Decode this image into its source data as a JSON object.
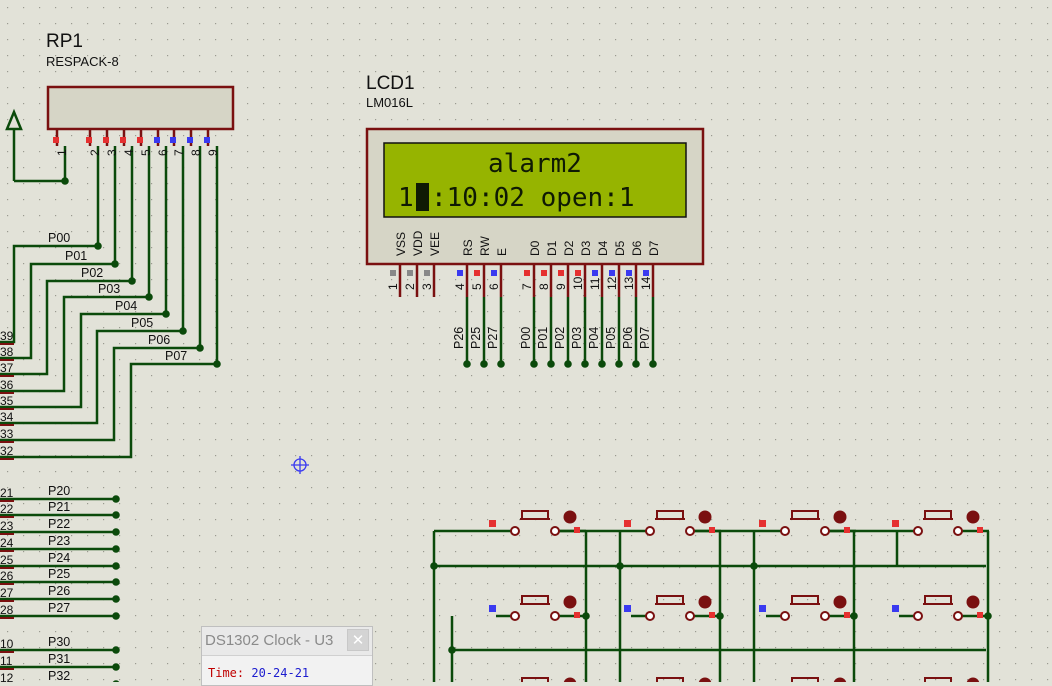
{
  "rp1": {
    "ref": "RP1",
    "value": "RESPACK-8",
    "pins": [
      "1",
      "2",
      "3",
      "4",
      "5",
      "6",
      "7",
      "8",
      "9"
    ]
  },
  "lcd": {
    "ref": "LCD1",
    "value": "LM016L",
    "line1": "alarm2",
    "line2_a": "1",
    "line2_b": ":10:02 open:1",
    "pin_names": [
      "VSS",
      "VDD",
      "VEE",
      "RS",
      "RW",
      "E",
      "D0",
      "D1",
      "D2",
      "D3",
      "D4",
      "D5",
      "D6",
      "D7"
    ],
    "pin_numbers": [
      "1",
      "2",
      "3",
      "4",
      "5",
      "6",
      "7",
      "8",
      "9",
      "10",
      "11",
      "12",
      "13",
      "14"
    ],
    "net_labels": [
      "P26",
      "P25",
      "P27",
      "P00",
      "P01",
      "P02",
      "P03",
      "P04",
      "P05",
      "P06",
      "P07"
    ]
  },
  "p0_labels": [
    "P00",
    "P01",
    "P02",
    "P03",
    "P04",
    "P05",
    "P06",
    "P07"
  ],
  "p0_pins": [
    "39",
    "38",
    "37",
    "36",
    "35",
    "34",
    "33",
    "32"
  ],
  "p2_labels": [
    "P20",
    "P21",
    "P22",
    "P23",
    "P24",
    "P25",
    "P26",
    "P27"
  ],
  "p2_pins": [
    "21",
    "22",
    "23",
    "24",
    "25",
    "26",
    "27",
    "28"
  ],
  "p3_labels": [
    "P30",
    "P31",
    "P32"
  ],
  "p3_pins": [
    "10",
    "11",
    "12"
  ],
  "popup": {
    "title": "DS1302 Clock - U3",
    "close": "✕",
    "time_label": "Time:",
    "time_value": "20-24-21"
  },
  "colors": {
    "wire": "#0b4a0b",
    "component": "#7a1010",
    "lcd_screen": "#96b400",
    "pin_red": "#e53030",
    "pin_blue": "#3a3af0",
    "background": "#e2e2d8"
  }
}
